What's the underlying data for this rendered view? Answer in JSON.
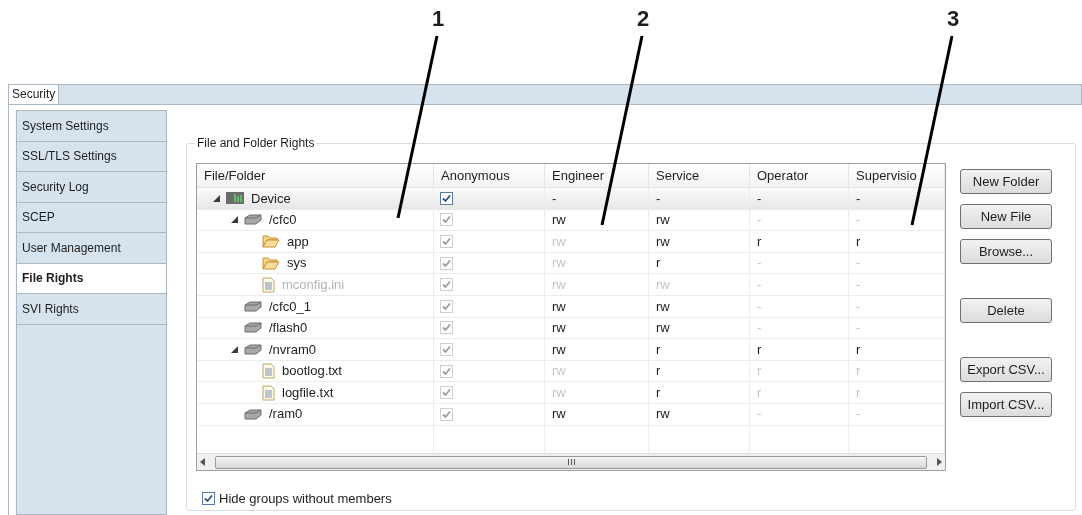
{
  "callouts": [
    {
      "label": "1"
    },
    {
      "label": "2"
    },
    {
      "label": "3"
    }
  ],
  "tabs": [
    {
      "label": "Security",
      "selected": true
    }
  ],
  "sidebar": {
    "items": [
      {
        "label": "System Settings",
        "selected": false
      },
      {
        "label": "SSL/TLS Settings",
        "selected": false
      },
      {
        "label": "Security Log",
        "selected": false
      },
      {
        "label": "SCEP",
        "selected": false
      },
      {
        "label": "User Management",
        "selected": false
      },
      {
        "label": "File Rights",
        "selected": true
      },
      {
        "label": "SVI Rights",
        "selected": false
      }
    ]
  },
  "group": {
    "title": "File and Folder Rights"
  },
  "table": {
    "columns": [
      "File/Folder",
      "Anonymous",
      "Engineer",
      "Service",
      "Operator",
      "Supervisio"
    ],
    "rows": [
      {
        "name": "Device",
        "kind": "device",
        "expanded": true,
        "dimmed": false,
        "selected": true,
        "anonymous": {
          "checked": true,
          "disabled": false
        },
        "rights": [
          {
            "text": "-",
            "dimmed": false
          },
          {
            "text": "-",
            "dimmed": false
          },
          {
            "text": "-",
            "dimmed": false
          },
          {
            "text": "-",
            "dimmed": false
          }
        ],
        "children": [
          {
            "name": "/cfc0",
            "kind": "drive",
            "expanded": true,
            "dimmed": false,
            "selected": false,
            "anonymous": {
              "checked": true,
              "disabled": true
            },
            "rights": [
              {
                "text": "rw",
                "dimmed": false
              },
              {
                "text": "rw",
                "dimmed": false
              },
              {
                "text": "-",
                "dimmed": true
              },
              {
                "text": "-",
                "dimmed": true
              }
            ],
            "children": [
              {
                "name": "app",
                "kind": "folder",
                "dimmed": false,
                "selected": false,
                "anonymous": {
                  "checked": true,
                  "disabled": true
                },
                "rights": [
                  {
                    "text": "rw",
                    "dimmed": true
                  },
                  {
                    "text": "rw",
                    "dimmed": false
                  },
                  {
                    "text": "r",
                    "dimmed": false
                  },
                  {
                    "text": "r",
                    "dimmed": false
                  }
                ]
              },
              {
                "name": "sys",
                "kind": "folder",
                "dimmed": false,
                "selected": false,
                "anonymous": {
                  "checked": true,
                  "disabled": true
                },
                "rights": [
                  {
                    "text": "rw",
                    "dimmed": true
                  },
                  {
                    "text": "r",
                    "dimmed": false
                  },
                  {
                    "text": "-",
                    "dimmed": true
                  },
                  {
                    "text": "-",
                    "dimmed": true
                  }
                ]
              },
              {
                "name": "mconfig.ini",
                "kind": "file",
                "dimmed": true,
                "selected": false,
                "anonymous": {
                  "checked": true,
                  "disabled": true
                },
                "rights": [
                  {
                    "text": "rw",
                    "dimmed": true
                  },
                  {
                    "text": "rw",
                    "dimmed": true
                  },
                  {
                    "text": "-",
                    "dimmed": true
                  },
                  {
                    "text": "-",
                    "dimmed": true
                  }
                ]
              }
            ]
          },
          {
            "name": "/cfc0_1",
            "kind": "drive",
            "dimmed": false,
            "selected": false,
            "anonymous": {
              "checked": true,
              "disabled": true
            },
            "rights": [
              {
                "text": "rw",
                "dimmed": false
              },
              {
                "text": "rw",
                "dimmed": false
              },
              {
                "text": "-",
                "dimmed": true
              },
              {
                "text": "-",
                "dimmed": true
              }
            ]
          },
          {
            "name": "/flash0",
            "kind": "drive",
            "dimmed": false,
            "selected": false,
            "anonymous": {
              "checked": true,
              "disabled": true
            },
            "rights": [
              {
                "text": "rw",
                "dimmed": false
              },
              {
                "text": "rw",
                "dimmed": false
              },
              {
                "text": "-",
                "dimmed": true
              },
              {
                "text": "-",
                "dimmed": true
              }
            ]
          },
          {
            "name": "/nvram0",
            "kind": "drive",
            "expanded": true,
            "dimmed": false,
            "selected": false,
            "anonymous": {
              "checked": true,
              "disabled": true
            },
            "rights": [
              {
                "text": "rw",
                "dimmed": false
              },
              {
                "text": "r",
                "dimmed": false
              },
              {
                "text": "r",
                "dimmed": false
              },
              {
                "text": "r",
                "dimmed": false
              }
            ],
            "children": [
              {
                "name": "bootlog.txt",
                "kind": "file",
                "dimmed": false,
                "selected": false,
                "anonymous": {
                  "checked": true,
                  "disabled": true
                },
                "rights": [
                  {
                    "text": "rw",
                    "dimmed": true
                  },
                  {
                    "text": "r",
                    "dimmed": false
                  },
                  {
                    "text": "r",
                    "dimmed": true
                  },
                  {
                    "text": "r",
                    "dimmed": true
                  }
                ]
              },
              {
                "name": "logfile.txt",
                "kind": "file",
                "dimmed": false,
                "selected": false,
                "anonymous": {
                  "checked": true,
                  "disabled": true
                },
                "rights": [
                  {
                    "text": "rw",
                    "dimmed": true
                  },
                  {
                    "text": "r",
                    "dimmed": false
                  },
                  {
                    "text": "r",
                    "dimmed": true
                  },
                  {
                    "text": "r",
                    "dimmed": true
                  }
                ]
              }
            ]
          },
          {
            "name": "/ram0",
            "kind": "drive",
            "dimmed": false,
            "selected": false,
            "anonymous": {
              "checked": true,
              "disabled": true
            },
            "rights": [
              {
                "text": "rw",
                "dimmed": false
              },
              {
                "text": "rw",
                "dimmed": false
              },
              {
                "text": "-",
                "dimmed": true
              },
              {
                "text": "-",
                "dimmed": true
              }
            ]
          }
        ]
      }
    ]
  },
  "buttons": [
    {
      "label": "New Folder"
    },
    {
      "label": "New File"
    },
    {
      "label": "Browse..."
    },
    {
      "label": "Delete"
    },
    {
      "label": "Export CSV..."
    },
    {
      "label": "Import CSV..."
    }
  ],
  "hide_groups": {
    "label": "Hide groups without members",
    "checked": true
  }
}
